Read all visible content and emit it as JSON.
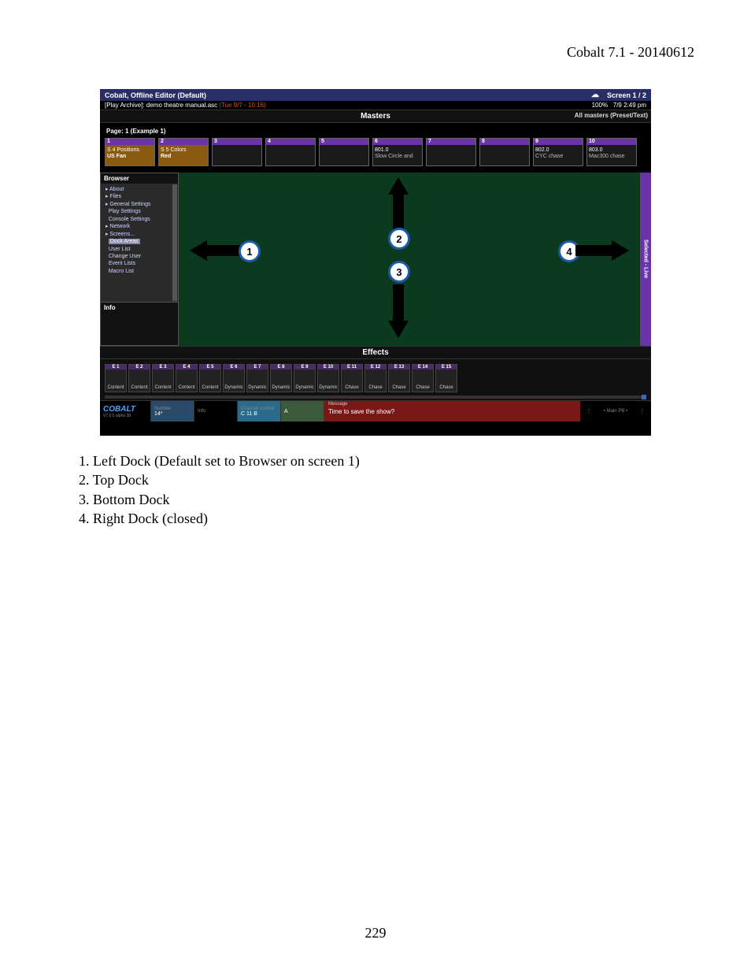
{
  "doc": {
    "header": "Cobalt 7.1 - 20140612",
    "page_number": "229"
  },
  "list": {
    "i1": "1. Left Dock (Default set to Browser on screen 1)",
    "i2": "2. Top Dock",
    "i3": "3. Bottom Dock",
    "i4": "4. Right Dock (closed)"
  },
  "title": {
    "line1": "Cobalt, Offline Editor (Default)",
    "line2a": "[Play Archive]: demo theatre manual.asc",
    "line2b": "(Tue 9/7 - 10:16)",
    "zoom": "100%",
    "screen": "Screen 1 / 2",
    "time": "7/9 2:49 pm"
  },
  "masters": {
    "title": "Masters",
    "side": "All masters (Preset/Text)",
    "page": "Page: 1 (Example 1)",
    "cards": [
      {
        "n": "1",
        "l1": "S 4 Positions",
        "l2": "US Fan",
        "cls": "orange"
      },
      {
        "n": "2",
        "l1": "S 5 Colors",
        "l2": "Red",
        "cls": "orange"
      },
      {
        "n": "3",
        "l1": "",
        "l2": ""
      },
      {
        "n": "4",
        "l1": "",
        "l2": ""
      },
      {
        "n": "5",
        "l1": "",
        "l2": ""
      },
      {
        "n": "6",
        "l1": "801.0",
        "l2": "Slow Circle and"
      },
      {
        "n": "7",
        "l1": "",
        "l2": ""
      },
      {
        "n": "8",
        "l1": "",
        "l2": ""
      },
      {
        "n": "9",
        "l1": "802.0",
        "l2": "CYC chase"
      },
      {
        "n": "10",
        "l1": "803.0",
        "l2": "Mac300 chase"
      }
    ]
  },
  "browser": {
    "title": "Browser",
    "items": [
      "About",
      "Files",
      "General Settings",
      "Play Settings",
      "Console Settings",
      "Network",
      "Screens...",
      "Dock Areas",
      "User List",
      "Change User",
      "Event Lists",
      "Macro List"
    ],
    "info": "Info"
  },
  "right_tab": "Selected - Live",
  "callouts": {
    "c1": "1",
    "c2": "2",
    "c3": "3",
    "c4": "4"
  },
  "effects": {
    "title": "Effects",
    "items": [
      {
        "t": "E 1",
        "l": "Content"
      },
      {
        "t": "E 2",
        "l": "Content"
      },
      {
        "t": "E 3",
        "l": "Content"
      },
      {
        "t": "E 4",
        "l": "Content"
      },
      {
        "t": "E 5",
        "l": "Content"
      },
      {
        "t": "E 6",
        "l": "Dynamic"
      },
      {
        "t": "E 7",
        "l": "Dynamic"
      },
      {
        "t": "E 8",
        "l": "Dynamic"
      },
      {
        "t": "E 9",
        "l": "Dynamic"
      },
      {
        "t": "E 10",
        "l": "Dynamic"
      },
      {
        "t": "E 11",
        "l": "Chase"
      },
      {
        "t": "E 12",
        "l": "Chase"
      },
      {
        "t": "E 13",
        "l": "Chase"
      },
      {
        "t": "E 14",
        "l": "Chase"
      },
      {
        "t": "E 15",
        "l": "Chase"
      }
    ]
  },
  "footer": {
    "logo": "COBALT",
    "version": "V7.0.0 alpha 38",
    "number_lab": "Number",
    "number_val": "14*",
    "info_lab": "Info",
    "cc_lab": "Channel control",
    "cc_val": "C 11 B",
    "a_val": "A",
    "msg_lab": "Message",
    "msg_val": "Time to save the show?",
    "mainpb": "• Main PB •"
  }
}
